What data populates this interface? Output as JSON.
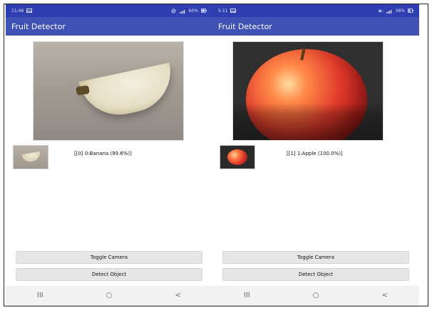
{
  "screens": [
    {
      "id": "left",
      "status": {
        "time": "11:46",
        "left_icon": "picture-icon",
        "right_text": "60%",
        "right_icons": [
          "silent-icon",
          "signal-icon",
          "battery-icon"
        ]
      },
      "app_title": "Fruit Detector",
      "main_image": {
        "name": "banana-photo"
      },
      "thumb_image": {
        "name": "banana-thumbnail"
      },
      "result_text": "[[0] 0:Banana (99.6%)]",
      "buttons": {
        "toggle_camera": "Toggle Camera",
        "detect_object": "Detect Object"
      },
      "navbar": {
        "recent": "III",
        "home": "○",
        "back": "<"
      }
    },
    {
      "id": "right",
      "status": {
        "time": "5:11",
        "left_icon": "picture-icon",
        "right_text": "36%",
        "right_icons": [
          "mute-icon",
          "signal-icon",
          "battery-icon"
        ]
      },
      "app_title": "Fruit Detector",
      "main_image": {
        "name": "apple-photo"
      },
      "thumb_image": {
        "name": "apple-thumbnail"
      },
      "result_text": "[[1] 1:Apple (100.0%)]",
      "buttons": {
        "toggle_camera": "Toggle Camera",
        "detect_object": "Detect Object"
      },
      "navbar": {
        "recent": "III",
        "home": "○",
        "back": "<"
      }
    }
  ],
  "colors": {
    "statusbar": "#2f3eb0",
    "appbar": "#3f51b5",
    "button_bg": "#e6e6e6"
  }
}
